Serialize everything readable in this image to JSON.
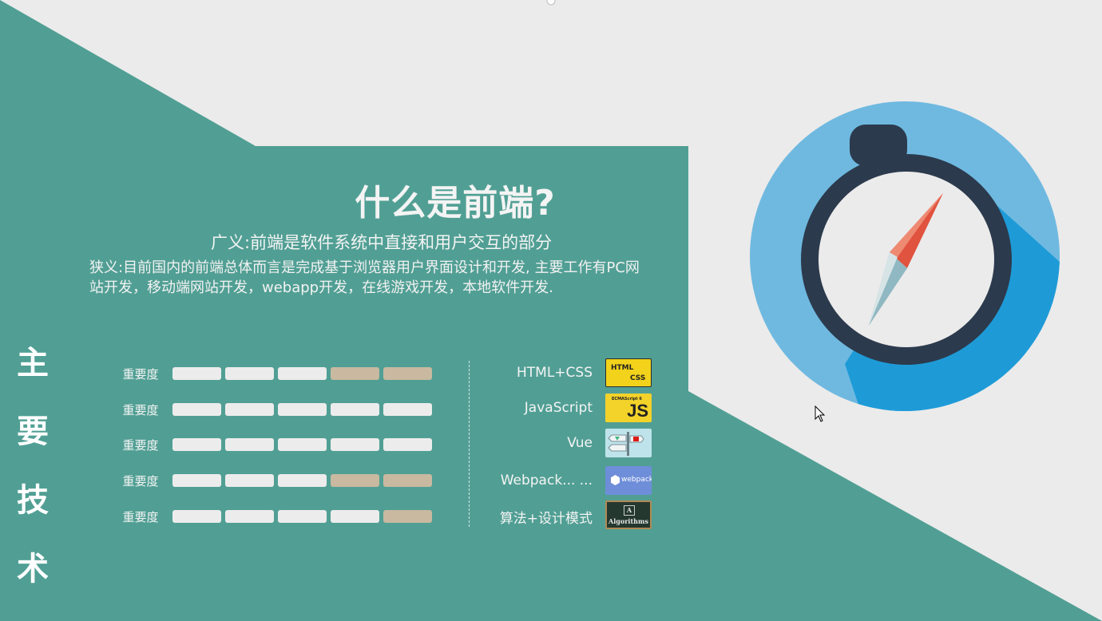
{
  "slide": {
    "title": "什么是前端?",
    "broad_definition": "广义:前端是软件系统中直接和用户交互的部分",
    "narrow_definition": "狭义:目前国内的前端总体而言是完成基于浏览器用户界面设计和开发, 主要工作有PC网站开发，移动端网站开发，webapp开发，在线游戏开发，本地软件开发.",
    "side_title": [
      "主",
      "要",
      "技",
      "术"
    ]
  },
  "ratings": [
    {
      "label": "重要度",
      "level": 3,
      "max": 5
    },
    {
      "label": "重要度",
      "level": 5,
      "max": 5
    },
    {
      "label": "重要度",
      "level": 5,
      "max": 5
    },
    {
      "label": "重要度",
      "level": 3,
      "max": 5
    },
    {
      "label": "重要度",
      "level": 4,
      "max": 5
    }
  ],
  "technologies": [
    {
      "name": "HTML+CSS",
      "icon": "html-css-logo",
      "icon_text": [
        "HTML",
        "CSS"
      ]
    },
    {
      "name": "JavaScript",
      "icon": "javascript-logo",
      "icon_text": [
        "ECMAScript 6",
        "JS"
      ]
    },
    {
      "name": "Vue",
      "icon": "vue-angular-signpost-logo",
      "icon_text": []
    },
    {
      "name": "Webpack... ...",
      "icon": "webpack-logo",
      "icon_text": [
        "webpack"
      ]
    },
    {
      "name": "算法+设计模式",
      "icon": "algorithms-book-logo",
      "icon_text": [
        "A",
        "Algorithms"
      ]
    }
  ],
  "colors": {
    "teal": "#519f94",
    "background": "#ebebeb",
    "segment_on": "#ececec",
    "segment_off": "#c8b9a0",
    "compass_light_blue": "#6fb9e0",
    "compass_blue": "#1e9bd7",
    "compass_ring": "#2c3a4d",
    "needle_red": "#e0533e",
    "needle_light": "#c9dde0"
  }
}
